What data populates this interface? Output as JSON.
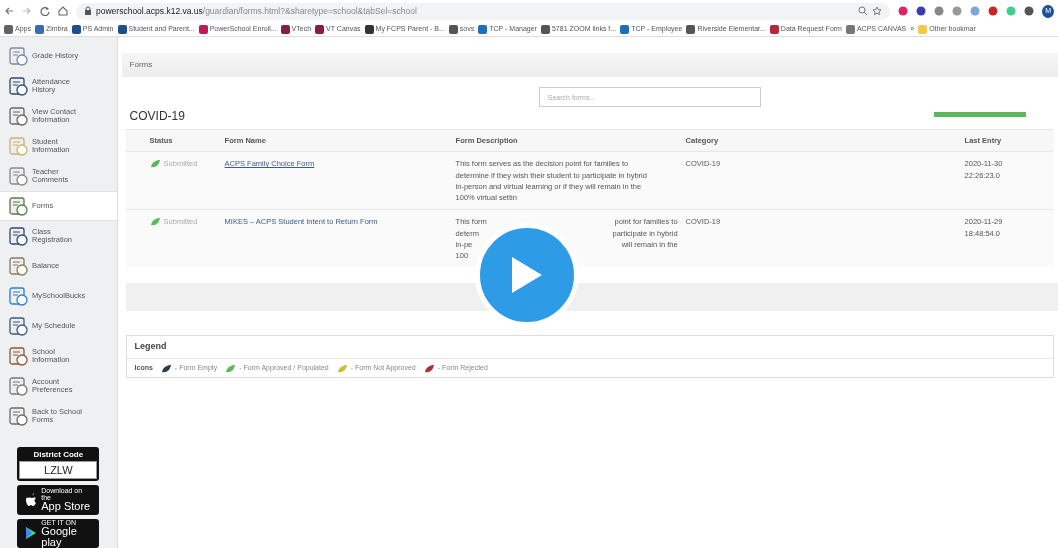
{
  "browser": {
    "url_host": "powerschool.acps.k12.va.us",
    "url_path": "/guardian/forms.html?&sharetype=school&tabSel=school",
    "profile_initial": "M",
    "bookmarks": [
      {
        "label": "Apps",
        "color": "#5f6368"
      },
      {
        "label": "Zimbra",
        "color": "#3b6bb5"
      },
      {
        "label": "PS Admin",
        "color": "#1f4e8c"
      },
      {
        "label": "Student and Parent...",
        "color": "#1f4e8c"
      },
      {
        "label": "PowerSchool Enroll...",
        "color": "#c2185b"
      },
      {
        "label": "VTech",
        "color": "#861f41"
      },
      {
        "label": "VT Canvas",
        "color": "#861f41"
      },
      {
        "label": "My FCPS Parent - B...",
        "color": "#333333"
      },
      {
        "label": "sovs",
        "color": "#555555"
      },
      {
        "label": "TCP - Manager",
        "color": "#1e6fb8"
      },
      {
        "label": "5781 ZOOM links f...",
        "color": "#555555"
      },
      {
        "label": "TCP - Employee",
        "color": "#1e6fb8"
      },
      {
        "label": "Riverside Elementar...",
        "color": "#555555"
      },
      {
        "label": "Data Request Form",
        "color": "#b5283b"
      },
      {
        "label": "ACPS CANVAS",
        "color": "#777777"
      },
      {
        "label": "»"
      },
      {
        "label": "Other bookmar",
        "color": "#f3c94e"
      }
    ]
  },
  "sidebar": {
    "items": [
      {
        "label": "Grade History",
        "selected": false
      },
      {
        "label": "Attendance History",
        "selected": false
      },
      {
        "label": "View Contact Information",
        "selected": false
      },
      {
        "label": "Student Information",
        "selected": false
      },
      {
        "label": "Teacher Comments",
        "selected": false
      },
      {
        "label": "Forms",
        "selected": true
      },
      {
        "label": "Class Registration",
        "selected": false
      },
      {
        "label": "Balance",
        "selected": false
      },
      {
        "label": "MySchoolBucks",
        "selected": false
      },
      {
        "label": "My Schedule",
        "selected": false
      },
      {
        "label": "School Information",
        "selected": false
      },
      {
        "label": "Account Preferences",
        "selected": false
      },
      {
        "label": "Back to School Forms",
        "selected": false
      }
    ],
    "district_code": {
      "title": "District Code",
      "value": "LZLW"
    },
    "app_store": {
      "small": "Download on the",
      "big": "App Store"
    },
    "google_play": {
      "small": "GET IT ON",
      "big": "Google play"
    }
  },
  "panel": {
    "title": "Forms",
    "search": {
      "placeholder": "Search forms..."
    },
    "section": "COVID-19",
    "progress": {
      "level": 1
    },
    "table": {
      "columns": [
        "Status",
        "Form Name",
        "Form Description",
        "Category",
        "Last Entry"
      ],
      "rows": [
        {
          "status": "Submitted",
          "name": "ACPS Family Choice Form",
          "underlined": true,
          "description_lines": [
            [
              "This form serves as the decision point for families to"
            ],
            [
              "determine if they wish their student to participate in hybrid"
            ],
            [
              "in-person and virtual learning or if they will remain in the"
            ],
            [
              "100% virtual settin"
            ]
          ],
          "category": "COVID-19",
          "last_entry": [
            "2020-11-30",
            "22:26:23.0"
          ]
        },
        {
          "status": "Submitted",
          "name": "MIKES – ACPS Student Intent to Return Form",
          "underlined": false,
          "description_lines": [
            [
              "This form",
              "point for families to"
            ],
            [
              "determ",
              "participate in hybrid"
            ],
            [
              "in-pe",
              "will remain in the"
            ],
            [
              "100"
            ]
          ],
          "category": "COVID-19",
          "last_entry": [
            "2020-11-29",
            "18:48:54.0"
          ]
        }
      ]
    }
  },
  "legend": {
    "title": "Legend",
    "label": "Icons",
    "items": [
      {
        "label": "- Form Empty",
        "color": "#2c3e50"
      },
      {
        "label": "- Form Approved / Populated",
        "color": "#5cb85c"
      },
      {
        "label": "- Form Not Approved",
        "color": "#c9c043"
      },
      {
        "label": "- Form Rejected",
        "color": "#a8323a"
      }
    ]
  }
}
